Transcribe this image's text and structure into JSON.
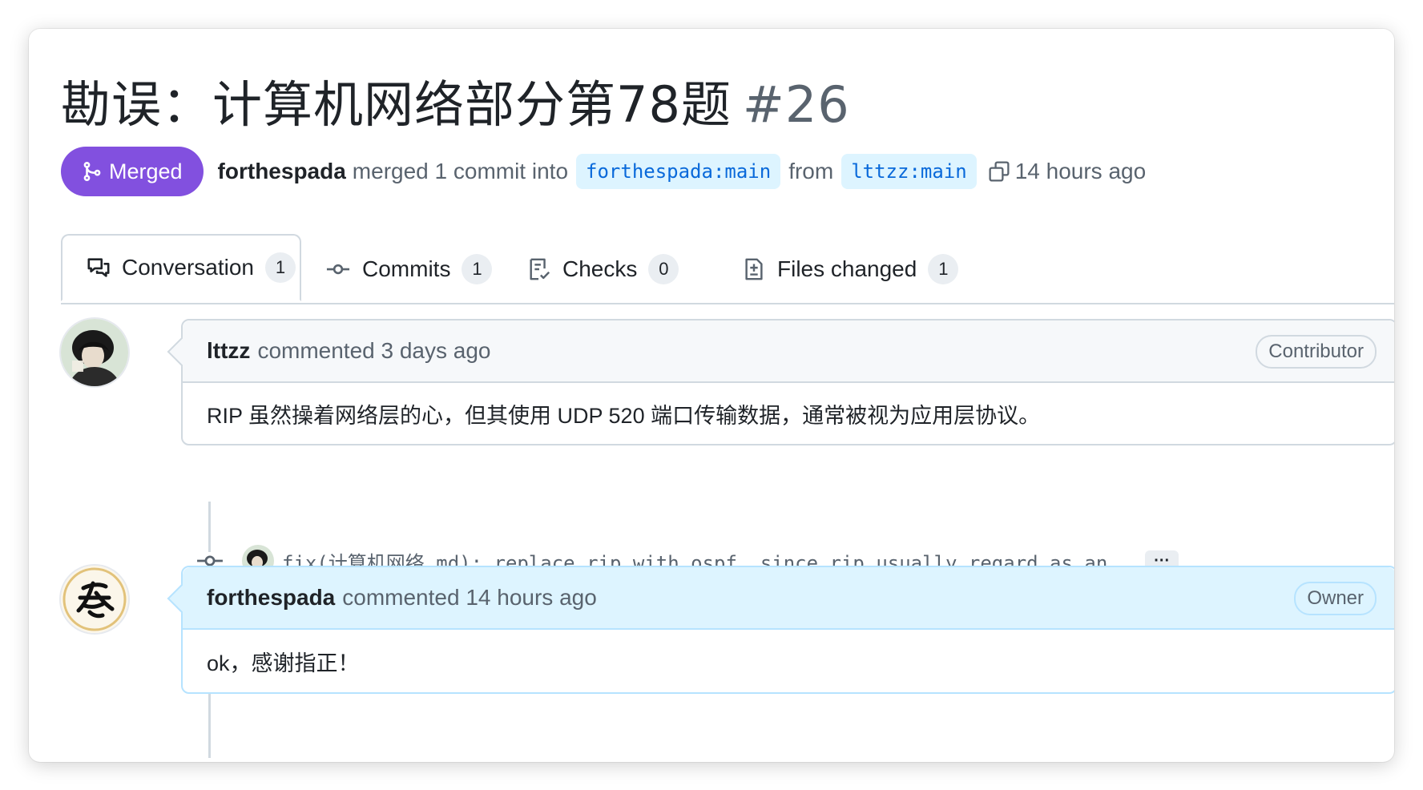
{
  "pr": {
    "title": "勘误：计算机网络部分第78题",
    "number": "#26",
    "status": "Merged",
    "author": "forthespada",
    "merge_text": "merged 1 commit into",
    "base_branch": "forthespada:main",
    "from_text": "from",
    "head_branch": "lttzz:main",
    "time": "14 hours ago"
  },
  "tabs": [
    {
      "label": "Conversation",
      "count": "1",
      "icon": "comment-discussion-icon"
    },
    {
      "label": "Commits",
      "count": "1",
      "icon": "git-commit-icon"
    },
    {
      "label": "Checks",
      "count": "0",
      "icon": "checklist-icon"
    },
    {
      "label": "Files changed",
      "count": "1",
      "icon": "file-diff-icon"
    }
  ],
  "comments": [
    {
      "author": "lttzz",
      "action": "commented 3 days ago",
      "role": "Contributor",
      "body": "RIP 虽然操着网络层的心，但其使用 UDP 520 端口传输数据，通常被视为应用层协议。"
    },
    {
      "author": "forthespada",
      "action": "commented 14 hours ago",
      "role": "Owner",
      "body": "ok，感谢指正！"
    }
  ],
  "commit": {
    "message": "fix(计算机网络.md): replace rip with ospf, since rip usually regard as an …",
    "more": "···"
  },
  "colors": {
    "merged": "#8250df",
    "branch_bg": "#ddf4ff",
    "branch_fg": "#0969da",
    "owner_header": "#ddf4ff"
  }
}
